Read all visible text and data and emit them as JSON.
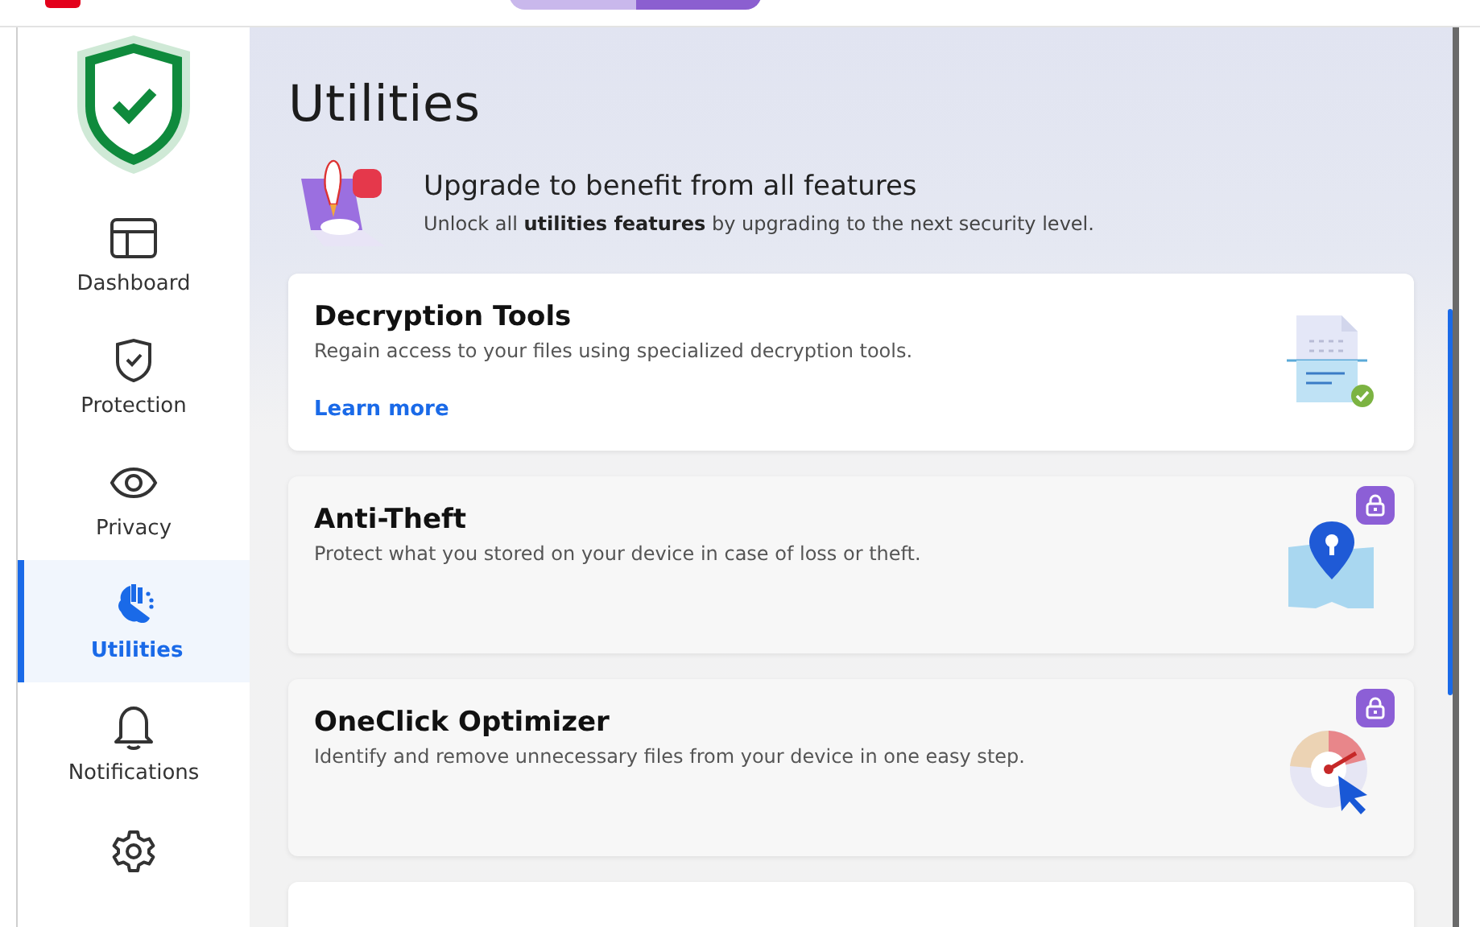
{
  "page_title": "Utilities",
  "nav": [
    {
      "label": "Dashboard",
      "kind": "dashboard",
      "selected": false
    },
    {
      "label": "Protection",
      "kind": "protection",
      "selected": false
    },
    {
      "label": "Privacy",
      "kind": "privacy",
      "selected": false
    },
    {
      "label": "Utilities",
      "kind": "utilities",
      "selected": true
    },
    {
      "label": "Notifications",
      "kind": "notifications",
      "selected": false
    },
    {
      "kind": "settings",
      "selected": false
    }
  ],
  "upgrade": {
    "title": "Upgrade to benefit from all features",
    "text": "Unlock all **utilities features** by upgrading to the next security level."
  },
  "cards": [
    {
      "title": "Decryption Tools",
      "description": "Regain access to your files using specialized decryption tools.",
      "link": "Learn more",
      "kind": "decryption",
      "locked": false
    },
    {
      "title": "Anti-Theft",
      "description": "Protect what you stored on your device in case of loss or theft.",
      "kind": "antitheft",
      "locked": true
    },
    {
      "title": "OneClick Optimizer",
      "description": "Identify and remove unnecessary files from your device in one easy step.",
      "kind": "optimizer",
      "locked": true
    },
    {
      "kind": "none",
      "locked": false
    }
  ]
}
